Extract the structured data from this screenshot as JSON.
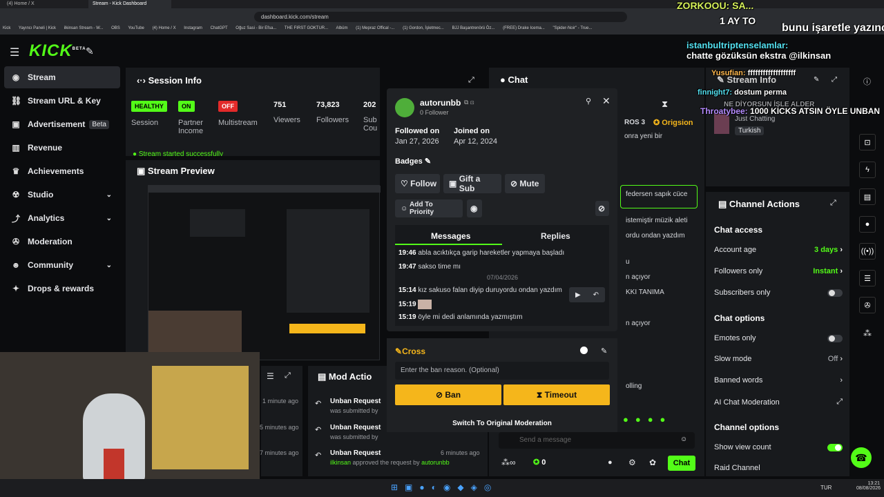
{
  "browser": {
    "tabs": [
      "(4) Home / X",
      "Stream - Kick Dashboard"
    ],
    "url": "dashboard.kick.com/stream",
    "bookmarks": [
      "Kick",
      "Yayıncı Paneli | Kick",
      "ilkinsan Stream - W...",
      "OBS",
      "YouTube",
      "(4) Home / X",
      "Instagram",
      "ChatGPT",
      "Oğuz Sasi - Bir Efsa...",
      "THE FIRST GOKTUR...",
      "Albüm",
      "(1) Mepraz Offical -...",
      "(1) Gordon, İşletmec...",
      "BJJ Başantrenörü Öz...",
      "(FREE) Drake Icema...",
      "\"Spider-Noir\" - True..."
    ]
  },
  "app": {
    "logo": "KICK",
    "logo_sup": "BETA"
  },
  "sidebar": {
    "items": [
      {
        "label": "Stream"
      },
      {
        "label": "Stream URL & Key"
      },
      {
        "label": "Advertisement",
        "badge": "Beta"
      },
      {
        "label": "Revenue"
      },
      {
        "label": "Achievements"
      },
      {
        "label": "Studio"
      },
      {
        "label": "Analytics"
      },
      {
        "label": "Moderation"
      },
      {
        "label": "Community"
      },
      {
        "label": "Drops & rewards"
      }
    ]
  },
  "session": {
    "title": "Session Info",
    "session_badge": "HEALTHY",
    "session_label": "Session",
    "partner_badge": "ON",
    "partner_label": "Partner Income",
    "multistream_badge": "OFF",
    "multistream_label": "Multistream",
    "viewers": "751",
    "viewers_label": "Viewers",
    "followers": "73,823",
    "followers_label": "Followers",
    "subs": "202",
    "subs_label": "Sub Cou",
    "status_msg": "Stream started successfully"
  },
  "preview": {
    "title": "Stream Preview"
  },
  "popup": {
    "username": "autorunbb",
    "followers": "0 Follower",
    "followed_label": "Followed on",
    "followed_date": "Jan 27, 2026",
    "joined_label": "Joined on",
    "joined_date": "Apr 12, 2024",
    "badges_label": "Badges",
    "follow": "Follow",
    "gift": "Gift a Sub",
    "mute": "Mute",
    "priority": "Add To Priority",
    "tab_messages": "Messages",
    "tab_replies": "Replies",
    "messages": [
      {
        "time": "19:46",
        "text": "abla acıktıkça garip hareketler yapmaya başladı"
      },
      {
        "time": "19:47",
        "text": "sakso time mı"
      },
      {
        "time": "",
        "text": "07/04/2026"
      },
      {
        "time": "15:14",
        "text": "kız sakuso falan diyip duruyordu ondan yazdım"
      },
      {
        "time": "15:19",
        "text": ""
      },
      {
        "time": "15:19",
        "text": "öyle mi dedi anlamında yazmıştım"
      }
    ]
  },
  "cross": {
    "title": "Cross",
    "placeholder": "Enter the ban reason. (Optional)",
    "ban": "Ban",
    "timeout": "Timeout",
    "switch": "Switch To Original Moderation"
  },
  "chat": {
    "title": "Chat",
    "tag1": "ROS",
    "tag1_n": "3",
    "tag2": "Origsion",
    "lines": [
      "onra yeni bir",
      "federsen sapık cüce",
      "istemiştir müzik aleti",
      "ordu ondan yazdım",
      "u",
      "n açıyor",
      "KKI TANIMA",
      "n açıyor",
      "olling"
    ],
    "input_placeholder": "Send a message",
    "count": "0",
    "chat_btn": "Chat"
  },
  "modactions": {
    "title": "Mod Actio",
    "times": [
      "1 minute ago",
      "5 minutes ago",
      "7 minutes ago"
    ],
    "items": [
      {
        "title": "Unban Request",
        "sub": "was submitted by",
        "time": ""
      },
      {
        "title": "Unban Request",
        "sub": "was submitted by",
        "time": ""
      },
      {
        "title": "Unban Request",
        "sub_user": "ilkinsan",
        "sub": "approved the request by",
        "sub_user2": "autorunbb",
        "time": "6 minutes ago"
      }
    ]
  },
  "stream_info": {
    "title": "Stream Info",
    "category": "Just Chatting",
    "tag": "Turkish"
  },
  "channel_actions": {
    "title": "Channel Actions",
    "chat_access": "Chat access",
    "account_age": "Account age",
    "account_age_val": "3 days",
    "followers_only": "Followers only",
    "followers_only_val": "Instant",
    "subscribers_only": "Subscribers only",
    "chat_options": "Chat options",
    "emotes_only": "Emotes only",
    "slow_mode": "Slow mode",
    "slow_mode_val": "Off",
    "banned_words": "Banned words",
    "ai_mod": "AI Chat Moderation",
    "channel_options": "Channel options",
    "show_view_count": "Show view count",
    "raid_channel": "Raid Channel"
  },
  "overlay": [
    {
      "user": "ZORKOOU:",
      "text": "SA..."
    },
    {
      "user": "",
      "text": "1 AY TO"
    },
    {
      "user": "",
      "text": "bunu işaretle yazınc"
    },
    {
      "user": "istanbultriptenselamlar:",
      "text": "chatte gözüksün ekstra @ilkinsan"
    },
    {
      "user": "Yusufian:",
      "text": "fffffffffffffffffff"
    },
    {
      "user": "finnight7:",
      "text": "dostum perma"
    },
    {
      "user": "",
      "text": "NE DİYORSUN İŞLE ALDER"
    },
    {
      "user": "Throatybee:",
      "text": "1000 KICKS ATSIN ÖYLE UNBAN"
    }
  ],
  "taskbar": {
    "lang": "TUR",
    "time": "13:21",
    "date": "08/08/2026"
  },
  "colors": {
    "accent": "#53fc18",
    "warning": "#f5b61b",
    "danger": "#e32a2a",
    "panel": "#181a1d"
  }
}
